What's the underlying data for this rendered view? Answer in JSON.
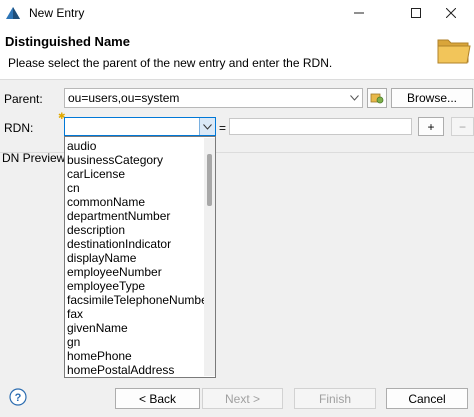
{
  "window": {
    "title": "New Entry",
    "minimize_icon": "minimize-icon",
    "maximize_icon": "maximize-icon",
    "close_icon": "close-icon"
  },
  "banner": {
    "title": "Distinguished Name",
    "description": "Please select the parent of the new entry and enter the RDN.",
    "image_icon": "folder-icon"
  },
  "form": {
    "parent_label": "Parent:",
    "parent_value": "ou=users,ou=system",
    "browse_button": "Browse...",
    "rdn_label": "RDN:",
    "rdn_attribute_value": "",
    "equals": "=",
    "rdn_value": "",
    "add_button": "+",
    "remove_button": "−",
    "dn_preview_label": "DN Preview:"
  },
  "dropdown": {
    "options": [
      "audio",
      "businessCategory",
      "carLicense",
      "cn",
      "commonName",
      "departmentNumber",
      "description",
      "destinationIndicator",
      "displayName",
      "employeeNumber",
      "employeeType",
      "facsimileTelephoneNumber",
      "fax",
      "givenName",
      "gn",
      "homePhone",
      "homePostalAddress"
    ]
  },
  "footer": {
    "back_button": "< Back",
    "next_button": "Next >",
    "finish_button": "Finish",
    "cancel_button": "Cancel",
    "help_icon": "help-icon"
  },
  "colors": {
    "accent": "#0078d7",
    "icon_blue": "#2b6cb0",
    "folder": "#e8b84a"
  }
}
